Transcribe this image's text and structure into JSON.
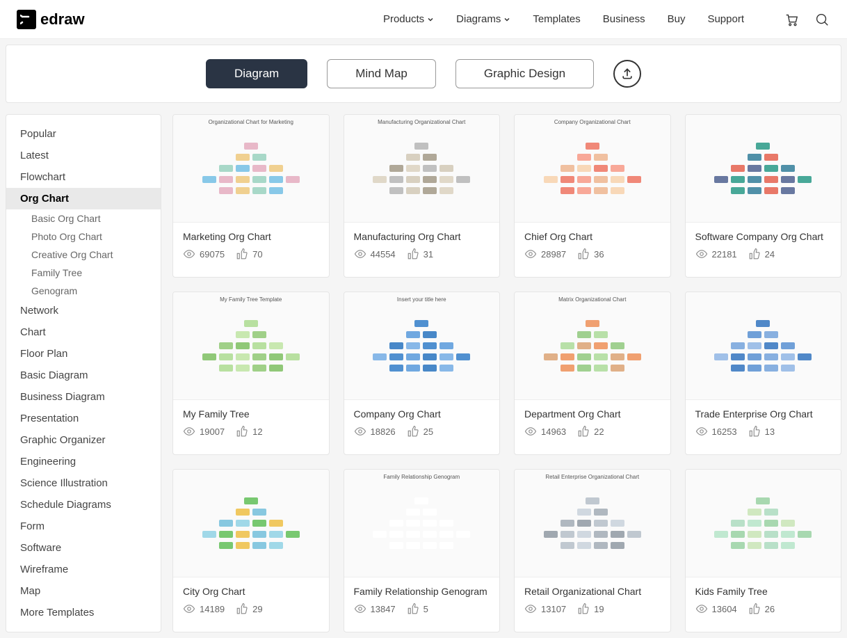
{
  "header": {
    "logo_text": "edraw",
    "nav": [
      "Products",
      "Diagrams",
      "Templates",
      "Business",
      "Buy",
      "Support"
    ],
    "nav_dropdown": [
      true,
      true,
      false,
      false,
      false,
      false
    ]
  },
  "tabs": {
    "items": [
      "Diagram",
      "Mind Map",
      "Graphic Design"
    ],
    "active": 0
  },
  "sidebar": {
    "items": [
      {
        "label": "Popular",
        "active": false
      },
      {
        "label": "Latest",
        "active": false
      },
      {
        "label": "Flowchart",
        "active": false
      },
      {
        "label": "Org Chart",
        "active": true,
        "children": [
          "Basic Org Chart",
          "Photo Org Chart",
          "Creative Org Chart",
          "Family Tree",
          "Genogram"
        ]
      },
      {
        "label": "Network",
        "active": false
      },
      {
        "label": "Chart",
        "active": false
      },
      {
        "label": "Floor Plan",
        "active": false
      },
      {
        "label": "Basic Diagram",
        "active": false
      },
      {
        "label": "Business Diagram",
        "active": false
      },
      {
        "label": "Presentation",
        "active": false
      },
      {
        "label": "Graphic Organizer",
        "active": false
      },
      {
        "label": "Engineering",
        "active": false
      },
      {
        "label": "Science Illustration",
        "active": false
      },
      {
        "label": "Schedule Diagrams",
        "active": false
      },
      {
        "label": "Form",
        "active": false
      },
      {
        "label": "Software",
        "active": false
      },
      {
        "label": "Wireframe",
        "active": false
      },
      {
        "label": "Map",
        "active": false
      },
      {
        "label": "More Templates",
        "active": false
      }
    ]
  },
  "templates": [
    {
      "title": "Marketing Org Chart",
      "views": "69075",
      "likes": "70",
      "thumb_title": "Organizational Chart for Marketing",
      "palette": [
        "#e8b8c8",
        "#f0d090",
        "#a8d8c8",
        "#88c8e8"
      ]
    },
    {
      "title": "Manufacturing Org Chart",
      "views": "44554",
      "likes": "31",
      "thumb_title": "Manufacturing Organizational Chart",
      "palette": [
        "#c0c0c0",
        "#d8d0c0",
        "#b0a898",
        "#e0d8c8"
      ]
    },
    {
      "title": "Chief Org Chart",
      "views": "28987",
      "likes": "36",
      "thumb_title": "Company Organizational Chart",
      "palette": [
        "#f08878",
        "#f8a898",
        "#f0c0a0",
        "#f8d8b8"
      ]
    },
    {
      "title": "Software Company Org Chart",
      "views": "22181",
      "likes": "24",
      "thumb_title": "",
      "palette": [
        "#48a898",
        "#5090a8",
        "#e87868",
        "#6878a0"
      ]
    },
    {
      "title": "My Family Tree",
      "views": "19007",
      "likes": "12",
      "thumb_title": "My Family Tree Template",
      "palette": [
        "#b8e0a0",
        "#c8e8b0",
        "#a0d088",
        "#90c878"
      ]
    },
    {
      "title": "Company Org Chart",
      "views": "18826",
      "likes": "25",
      "thumb_title": "Insert your title here",
      "palette": [
        "#5090d0",
        "#70a8e0",
        "#4888c8",
        "#88b8e8"
      ]
    },
    {
      "title": "Department Org Chart",
      "views": "14963",
      "likes": "22",
      "thumb_title": "Matrix Organizational Chart",
      "palette": [
        "#f0a070",
        "#a0d090",
        "#b8e0a8",
        "#e0b088"
      ]
    },
    {
      "title": "Trade Enterprise Org Chart",
      "views": "16253",
      "likes": "13",
      "thumb_title": "",
      "palette": [
        "#5088c8",
        "#70a0d8",
        "#88b0e0",
        "#a0c0e8"
      ]
    },
    {
      "title": "City Org Chart",
      "views": "14189",
      "likes": "29",
      "thumb_title": "",
      "palette": [
        "#78c870",
        "#f0c860",
        "#88c8e0",
        "#a0d8e8"
      ]
    },
    {
      "title": "Family Relationship Genogram",
      "views": "13847",
      "likes": "5",
      "thumb_title": "Family Relationship Genogram",
      "palette": [
        "#ffffff",
        "#ffffff",
        "#ffffff",
        "#ffffff"
      ]
    },
    {
      "title": "Retail Organizational Chart",
      "views": "13107",
      "likes": "19",
      "thumb_title": "Retail Enterprise Organizational Chart",
      "palette": [
        "#c0c8d0",
        "#d0d8e0",
        "#b0b8c0",
        "#a0a8b0"
      ]
    },
    {
      "title": "Kids Family Tree",
      "views": "13604",
      "likes": "26",
      "thumb_title": "",
      "palette": [
        "#a8d8b0",
        "#d0e8c0",
        "#b8e0c8",
        "#c0e8d0"
      ]
    }
  ]
}
